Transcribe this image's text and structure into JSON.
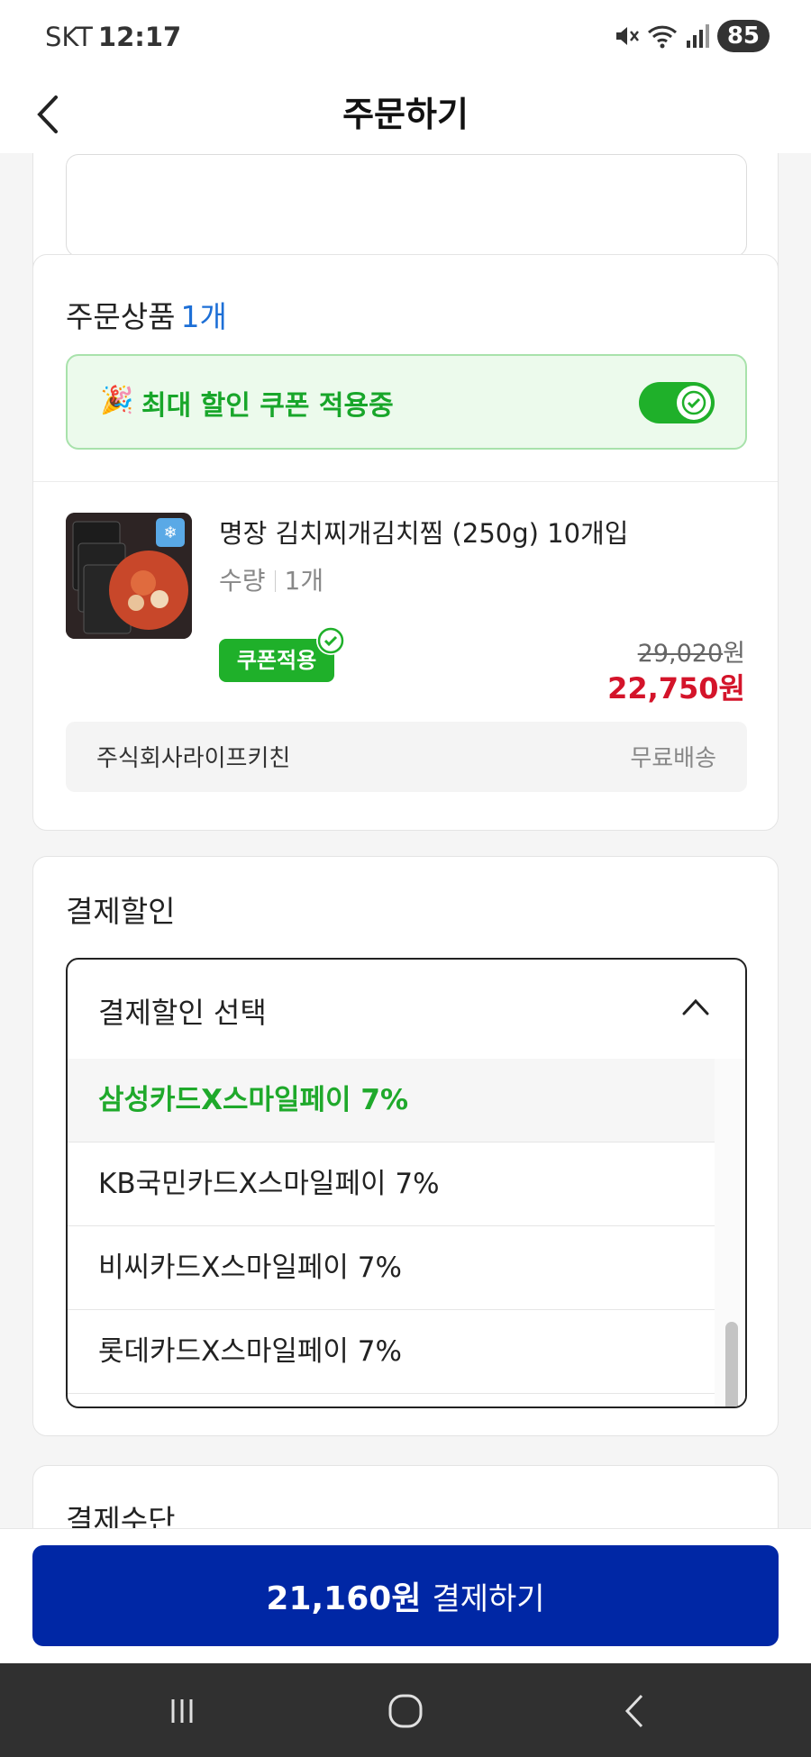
{
  "status_bar": {
    "carrier": "SKT",
    "time": "12:17",
    "battery": "85"
  },
  "header": {
    "title": "주문하기"
  },
  "order": {
    "section_title": "주문상품",
    "item_count": "1개",
    "coupon_banner": {
      "emoji": "🎉",
      "text": "최대 할인 쿠폰 적용중",
      "toggle_on": true
    },
    "product": {
      "name": "명장 김치찌개김치찜 (250g) 10개입",
      "qty_label": "수량",
      "qty_value": "1개",
      "coupon_badge": "쿠폰적용",
      "original_price": "29,020",
      "currency": "원",
      "sale_price": "22,750원"
    },
    "seller": {
      "name": "주식회사라이프키친",
      "shipping": "무료배송"
    }
  },
  "payment_discount": {
    "section_title": "결제할인",
    "dropdown_label": "결제할인 선택",
    "options": [
      {
        "label": "삼성카드X스마일페이 7%",
        "selected": true
      },
      {
        "label": "KB국민카드X스마일페이 7%",
        "selected": false
      },
      {
        "label": "비씨카드X스마일페이 7%",
        "selected": false
      },
      {
        "label": "롯데카드X스마일페이 7%",
        "selected": false
      }
    ]
  },
  "payment_method": {
    "section_title": "결제수단"
  },
  "pay_button": {
    "amount": "21,160원",
    "label": "결제하기"
  },
  "colors": {
    "accent_green": "#1fb02a",
    "pay_blue": "#0027a5",
    "sale_red": "#d4142a",
    "count_blue": "#1d6fd6"
  }
}
